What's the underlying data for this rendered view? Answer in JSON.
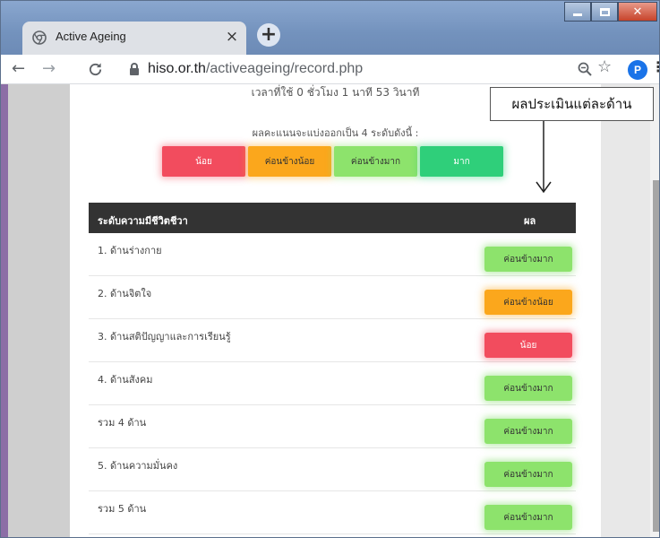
{
  "browser": {
    "tab_title": "Active Ageing",
    "tab_close": "×",
    "new_tab": "+",
    "url_host": "hiso.or.th",
    "url_path": "/activeageing/record.php",
    "profile_initial": "P"
  },
  "page": {
    "time_used": "เวลาที่ใช้ 0 ชั่วโมง 1 นาที 53 วินาที",
    "legend_title": "ผลคะแนนจะแบ่งออกเป็น 4 ระดับดังนี้ :",
    "legend": [
      {
        "label": "น้อย",
        "color": "#f24c5e"
      },
      {
        "label": "ค่อนข้างน้อย",
        "color": "#fba71c"
      },
      {
        "label": "ค่อนข้างมาก",
        "color": "#8de36c"
      },
      {
        "label": "มาก",
        "color": "#2fcf7a"
      }
    ],
    "table": {
      "header_left": "ระดับความมีชีวิตชีวา",
      "header_right": "ผล",
      "rows": [
        {
          "label": "1. ด้านร่างกาย",
          "result": "ค่อนข้างมาก",
          "level": "good"
        },
        {
          "label": "2. ด้านจิตใจ",
          "result": "ค่อนข้างน้อย",
          "level": "fair"
        },
        {
          "label": "3. ด้านสติปัญญาและการเรียนรู้",
          "result": "น้อย",
          "level": "poor"
        },
        {
          "label": "4. ด้านสังคม",
          "result": "ค่อนข้างมาก",
          "level": "good"
        },
        {
          "label": "รวม 4 ด้าน",
          "result": "ค่อนข้างมาก",
          "level": "good"
        },
        {
          "label": "5. ด้านความมั่นคง",
          "result": "ค่อนข้างมาก",
          "level": "good"
        },
        {
          "label": "รวม 5 ด้าน",
          "result": "ค่อนข้างมาก",
          "level": "good"
        }
      ]
    },
    "callout": "ผลประเมินแต่ละด้าน"
  },
  "icons": [
    "chrome-favicon",
    "back-icon",
    "forward-icon",
    "reload-icon",
    "lock-icon",
    "zoom-icon",
    "star-icon",
    "menu-icon",
    "arrow-down-icon"
  ]
}
